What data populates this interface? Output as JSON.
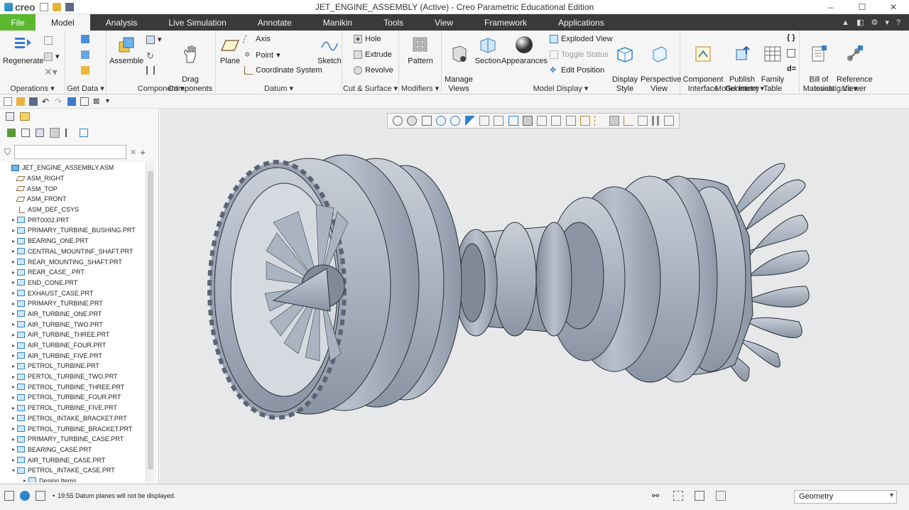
{
  "app": {
    "logo_text": "creo",
    "window_title": "JET_ENGINE_ASSEMBLY (Active) - Creo Parametric Educational Edition"
  },
  "tabs": [
    "File",
    "Model",
    "Analysis",
    "Live Simulation",
    "Annotate",
    "Manikin",
    "Tools",
    "View",
    "Framework",
    "Applications"
  ],
  "active_tab": "Model",
  "ribbon": {
    "operations": {
      "regenerate": "Regenerate",
      "group": "Operations"
    },
    "get_data": {
      "group": "Get Data"
    },
    "component": {
      "assemble": "Assemble",
      "drag": "Drag\nComponents",
      "group": "Component"
    },
    "datum": {
      "plane": "Plane",
      "axis": "Axis",
      "point": "Point",
      "coord": "Coordinate System",
      "sketch": "Sketch",
      "group": "Datum"
    },
    "cut_surface": {
      "hole": "Hole",
      "extrude": "Extrude",
      "revolve": "Revolve",
      "group": "Cut & Surface"
    },
    "modifiers": {
      "pattern": "Pattern",
      "group": "Modifiers"
    },
    "model_display": {
      "manage_views": "Manage\nViews",
      "section": "Section",
      "appearances": "Appearances",
      "exploded": "Exploded View",
      "toggle": "Toggle Status",
      "edit_position": "Edit Position",
      "display_style": "Display\nStyle",
      "perspective": "Perspective\nView",
      "group": "Model Display"
    },
    "model_intent": {
      "component_interface": "Component\nInterface",
      "publish": "Publish\nGeometry",
      "family": "Family\nTable",
      "group": "Model Intent"
    },
    "investigate": {
      "bom": "Bill of\nMaterials",
      "ref_viewer": "Reference\nViewer",
      "group": "Investigate"
    }
  },
  "tree": {
    "filter_placeholder": "",
    "items": [
      {
        "label": "JET_ENGINE_ASSEMBLY.ASM",
        "kind": "asm",
        "exp": ""
      },
      {
        "label": "ASM_RIGHT",
        "kind": "plane",
        "exp": ""
      },
      {
        "label": "ASM_TOP",
        "kind": "plane",
        "exp": ""
      },
      {
        "label": "ASM_FRONT",
        "kind": "plane",
        "exp": ""
      },
      {
        "label": "ASM_DEF_CSYS",
        "kind": "csys",
        "exp": ""
      },
      {
        "label": "PRT0002.PRT",
        "kind": "part",
        "exp": "▸"
      },
      {
        "label": "PRIMARY_TURBINE_BUSHING.PRT",
        "kind": "part",
        "exp": "▸"
      },
      {
        "label": "BEARING_ONE.PRT",
        "kind": "part",
        "exp": "▸"
      },
      {
        "label": "CENTRAL_MOUNTINF_SHAFT.PRT",
        "kind": "part",
        "exp": "▸"
      },
      {
        "label": "REAR_MOUNTING_SHAFT.PRT",
        "kind": "part",
        "exp": "▸"
      },
      {
        "label": "REAR_CASE_.PRT",
        "kind": "part",
        "exp": "▸"
      },
      {
        "label": "END_CONE.PRT",
        "kind": "part",
        "exp": "▸"
      },
      {
        "label": "EXHAUST_CASE.PRT",
        "kind": "part",
        "exp": "▸"
      },
      {
        "label": "PRIMARY_TURBINE.PRT",
        "kind": "part",
        "exp": "▸"
      },
      {
        "label": "AIR_TURBINE_ONE.PRT",
        "kind": "part",
        "exp": "▸"
      },
      {
        "label": "AIR_TURBINE_TWO.PRT",
        "kind": "part",
        "exp": "▸"
      },
      {
        "label": "AIR_TURBINE_THREE.PRT",
        "kind": "part",
        "exp": "▸"
      },
      {
        "label": "AIR_TURBINE_FOUR.PRT",
        "kind": "part",
        "exp": "▸"
      },
      {
        "label": "AIR_TURBINE_FIVE.PRT",
        "kind": "part",
        "exp": "▸"
      },
      {
        "label": "PETROL_TURBINE.PRT",
        "kind": "part",
        "exp": "▸"
      },
      {
        "label": "PERTOL_TURBINE_TWO.PRT",
        "kind": "part",
        "exp": "▸"
      },
      {
        "label": "PETROL_TURBINE_THREE.PRT",
        "kind": "part",
        "exp": "▸"
      },
      {
        "label": "PETROL_TURBINE_FOUR.PRT",
        "kind": "part",
        "exp": "▸"
      },
      {
        "label": "PETROL_TURBINE_FIVE.PRT",
        "kind": "part",
        "exp": "▸"
      },
      {
        "label": "PETROL_INTAKE_BRACKET.PRT",
        "kind": "part",
        "exp": "▸"
      },
      {
        "label": "PETROL_TURBINE_BRACKET.PRT",
        "kind": "part",
        "exp": "▸"
      },
      {
        "label": "PRIMARY_TURBINE_CASE.PRT",
        "kind": "part",
        "exp": "▸"
      },
      {
        "label": "BEARING_CASE.PRT",
        "kind": "part",
        "exp": "▸"
      },
      {
        "label": "AIR_TURBINE_CASE.PRT",
        "kind": "part",
        "exp": "▸"
      },
      {
        "label": "PETROL_INTAKE_CASE.PRT",
        "kind": "part",
        "exp": "▾"
      },
      {
        "label": "Design Items",
        "kind": "part",
        "exp": "▸"
      }
    ]
  },
  "status": {
    "message": "19:55 Datum planes will not be displayed.",
    "filter_value": "Geometry"
  },
  "colors": {
    "file_tab": "#5cb82f",
    "tabbar": "#3a3a3a",
    "viewport_bg": "#e6e8ea",
    "model": "#a9b2bf"
  }
}
